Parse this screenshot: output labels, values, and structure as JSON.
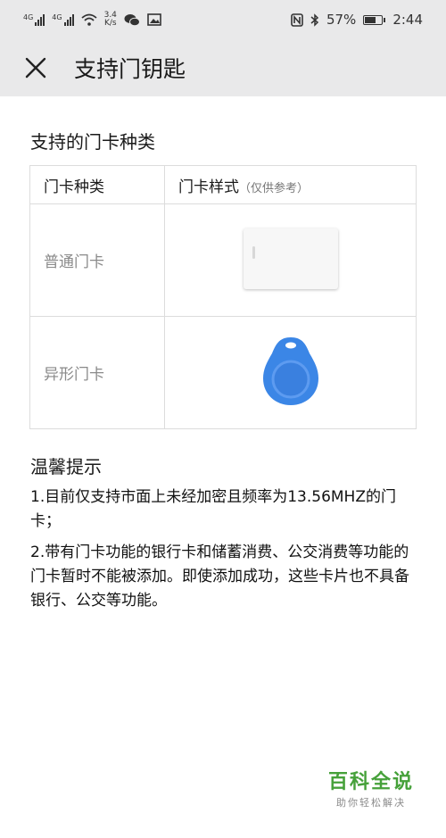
{
  "status_bar": {
    "sim1_label": "4G",
    "sim2_label": "4G",
    "speed_value": "3.4",
    "speed_unit": "K/s",
    "battery": "57%",
    "time": "2:44",
    "icons": [
      "signal-icon",
      "signal-icon",
      "wifi-icon",
      "wechat-icon",
      "image-icon",
      "nfc-icon",
      "bluetooth-icon",
      "battery-icon"
    ]
  },
  "navbar": {
    "title": "支持门钥匙",
    "close_icon": "close-icon"
  },
  "supported": {
    "title": "支持的门卡种类",
    "headers": {
      "type": "门卡种类",
      "style": "门卡样式",
      "style_note": "（仅供参考）"
    },
    "rows": [
      {
        "type": "普通门卡",
        "image": "white-card-image"
      },
      {
        "type": "异形门卡",
        "image": "blue-keyfob-image"
      }
    ]
  },
  "tips": {
    "title": "温馨提示",
    "items": [
      "1.目前仅支持市面上未经加密且频率为13.56MHZ的门卡；",
      "2.带有门卡功能的银行卡和储蓄消费、公交消费等功能的门卡暂时不能被添加。即使添加成功，这些卡片也不具备银行、公交等功能。"
    ]
  },
  "watermark": {
    "main": "百科全说",
    "sub": "助你轻松解决"
  },
  "colors": {
    "bar_bg": "#e9e9ea",
    "keyfob_blue": "#3b86e6",
    "watermark_green": "#46a13a"
  }
}
